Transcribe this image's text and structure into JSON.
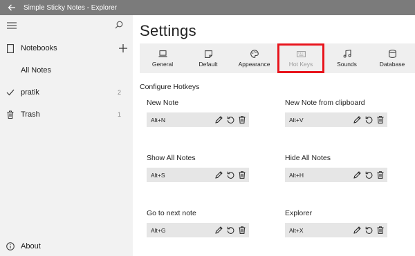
{
  "window": {
    "title": "Simple Sticky Notes - Explorer"
  },
  "sidebar": {
    "items": [
      {
        "label": "Notebooks",
        "icon": "notebook-icon",
        "action_icon": "plus-icon"
      },
      {
        "label": "All Notes"
      },
      {
        "label": "pratik",
        "icon": "checkmark-icon",
        "count": "2"
      },
      {
        "label": "Trash",
        "icon": "trash-icon",
        "count": "1"
      }
    ],
    "footer": {
      "label": "About",
      "icon": "info-icon"
    }
  },
  "main": {
    "title": "Settings",
    "tabs": [
      {
        "label": "General",
        "icon": "laptop-icon"
      },
      {
        "label": "Default",
        "icon": "note-icon"
      },
      {
        "label": "Appearance",
        "icon": "palette-icon"
      },
      {
        "label": "Hot Keys",
        "icon": "keyboard-icon",
        "state": "selected-disabled"
      },
      {
        "label": "Sounds",
        "icon": "music-icon"
      },
      {
        "label": "Database",
        "icon": "database-icon"
      }
    ],
    "section_title": "Configure Hotkeys",
    "hotkeys": [
      {
        "label": "New Note",
        "value": "Alt+N"
      },
      {
        "label": "New Note from clipboard",
        "value": "Alt+V"
      },
      {
        "label": "Show All Notes",
        "value": "Alt+S"
      },
      {
        "label": "Hide All Notes",
        "value": "Alt+H"
      },
      {
        "label": "Go to next note",
        "value": "Alt+G"
      },
      {
        "label": "Explorer",
        "value": "Alt+X"
      }
    ]
  },
  "colors": {
    "titlebar": "#7b7b7b",
    "sidebar": "#f2f2f2",
    "tabbar": "#efefef",
    "field": "#e6e6e6",
    "highlight": "#e8141c"
  }
}
